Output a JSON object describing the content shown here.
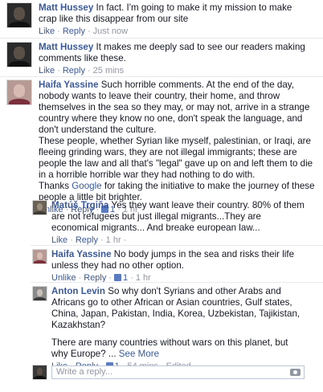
{
  "actions": {
    "like": "Like",
    "unlike": "Unlike",
    "reply": "Reply",
    "see_more": "See More",
    "dot": "·"
  },
  "comments": [
    {
      "author": "Matt Hussey",
      "text": "In fact. I'm going to make it my mission to make crap like this disappear from our site",
      "time": "Just now"
    },
    {
      "author": "Matt Hussey",
      "text": "It makes me deeply sad to see our readers making comments like these.",
      "time": "25 mins"
    },
    {
      "author": "Haifa Yassine",
      "paragraphs": [
        "Such horrible comments. At the end of the day, nobody wants to leave their country, their home, and throw themselves in the sea so they may, or may not, arrive in a strange country where they know no one, don't speak the language, and don't understand the culture.",
        "These people, whether Syrian like myself, palestinian, or Iraqi, are fleeing grinding wars, they are not illegal immigrants; these are people the law and all that's \"legal\" gave up on and left them to die in a horrible horrible war they had nothing to do with."
      ],
      "thanks_before": "Thanks ",
      "thanks_link": "Google",
      "thanks_after": " for taking the initiative to make the journey of these people a little bit brighter.",
      "likes": "1",
      "time": "1 hr"
    }
  ],
  "replies": [
    {
      "author": "Matúš Trgiňa",
      "text": "Yes they want leave their country. 80% of them are not refugees but just illegal migrants...They are economical migrants... And breake european law...",
      "time": "1 hr"
    },
    {
      "author": "Haifa Yassine",
      "text": "No body jumps in the sea and risks their life unless they had no other option.",
      "likes": "1",
      "time": "1 hr"
    },
    {
      "author": "Anton Levin",
      "text": "So why don't Syrians and other Arabs and Africans go to other African or Asian countries, Gulf states, China, Japan, Pakistan, India, Korea, Uzbekistan, Tajikistan, Kazakhstan?",
      "text2": "There are many countries without wars on this planet, but why Europe? ...",
      "likes": "1",
      "time": "54 mins",
      "edited": "Edited"
    }
  ],
  "reply_box": {
    "placeholder": "Write a reply..."
  }
}
